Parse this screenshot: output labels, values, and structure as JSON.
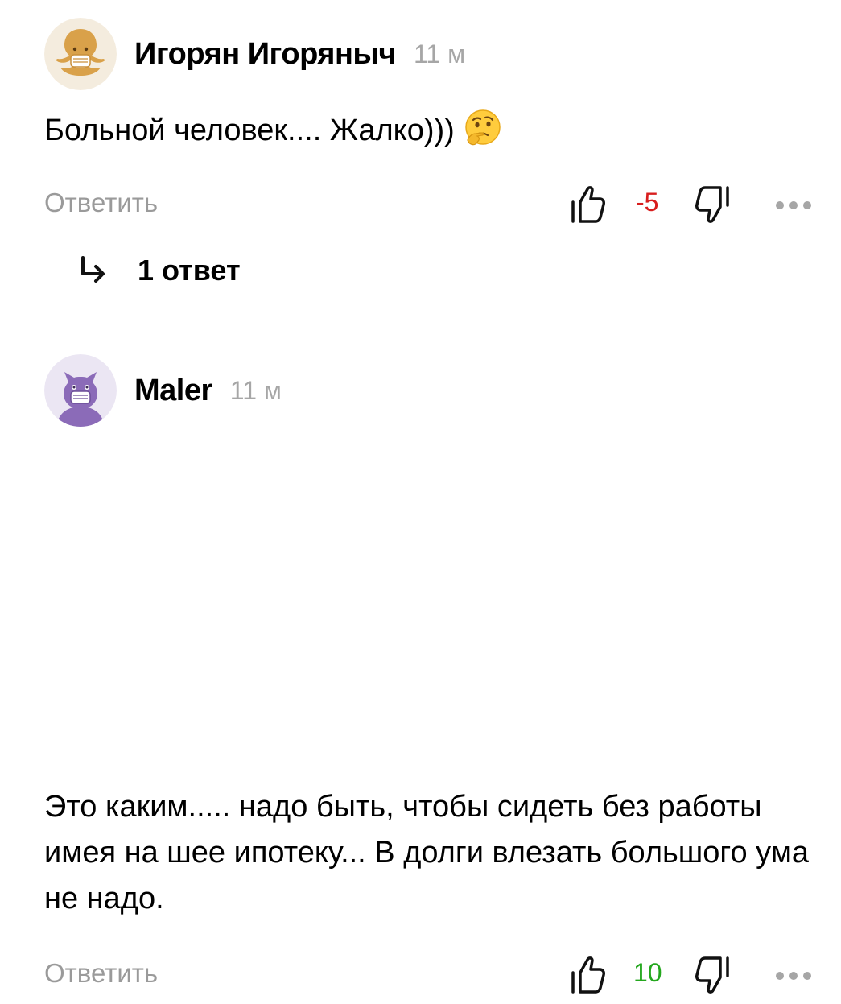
{
  "comments": [
    {
      "author": "Игорян Игоряныч",
      "time": "11 м",
      "text": "Больной человек.... Жалко)))",
      "emoji": "thinking-face",
      "reply_label": "Ответить",
      "score": "-5",
      "score_color": "#d81e1e",
      "replies_label": "1 ответ"
    },
    {
      "author": "Maler",
      "time": "11 м",
      "text": "Это каким..... надо быть, чтобы сидеть без работы имея на шее ипотеку... В долги влезать большого ума не надо.",
      "reply_label": "Ответить",
      "score": "10",
      "score_color": "#24a71e"
    }
  ],
  "icons": {
    "like": "thumbs-up-icon",
    "dislike": "thumbs-down-icon",
    "more": "more-dots-icon",
    "replies": "reply-arrow-icon"
  }
}
